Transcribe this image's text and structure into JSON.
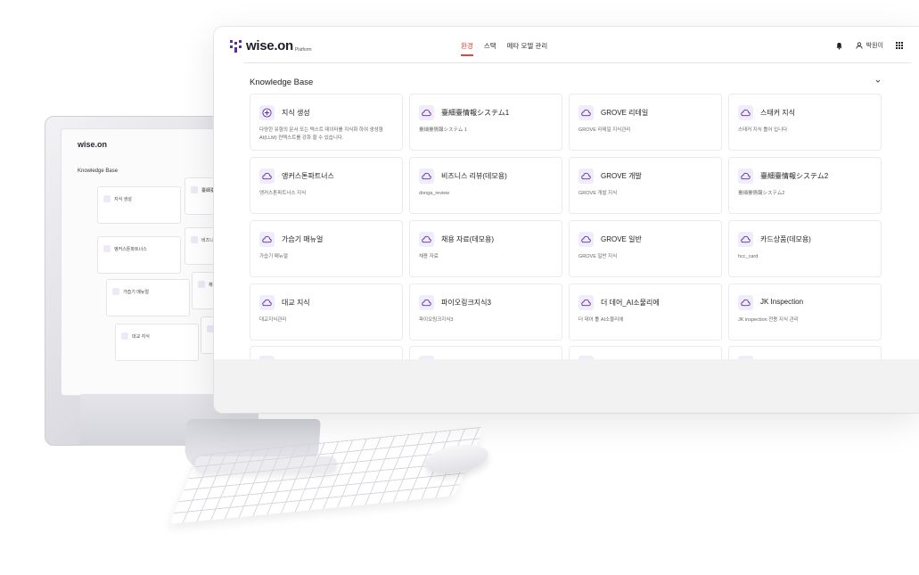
{
  "app": {
    "logo_text": "wise.on",
    "logo_sub": "Platform"
  },
  "nav": {
    "items": [
      "환경",
      "스택",
      "메타 모델 관리"
    ],
    "active_index": 0
  },
  "user": {
    "name": "박원이"
  },
  "section": {
    "title": "Knowledge Base"
  },
  "cards": [
    {
      "icon": "plus-circle-icon",
      "title": "지식 생성",
      "desc": "다양한 유형의 문서 또는 텍스트 데이터를 지식화 하여 생성형 AI(LLM) 컨텍스트를 강화 할 수 있습니다."
    },
    {
      "icon": "cloud-icon",
      "title": "臺細臺情報システム1",
      "desc": "臺細臺情報システム 1"
    },
    {
      "icon": "cloud-icon",
      "title": "GROVE 리테일",
      "desc": "GROVE 리테일 지식관리"
    },
    {
      "icon": "cloud-icon",
      "title": "스태커 지식",
      "desc": "스태커 지식 틀어 입니다"
    },
    {
      "icon": "cloud-icon",
      "title": "앵커스톤파트너스",
      "desc": "앵커스톤파트너스 지식"
    },
    {
      "icon": "cloud-icon",
      "title": "비즈니스 리뷰(데모용)",
      "desc": "donga_review"
    },
    {
      "icon": "cloud-icon",
      "title": "GROVE 개발",
      "desc": "GROVE 개발 지식"
    },
    {
      "icon": "cloud-icon",
      "title": "臺細臺情報システム2",
      "desc": "臺細臺情報システム2"
    },
    {
      "icon": "cloud-icon",
      "title": "가습기 매뉴얼",
      "desc": "가습기 매뉴얼"
    },
    {
      "icon": "cloud-icon",
      "title": "채용 자료(데모용)",
      "desc": "채용 자료"
    },
    {
      "icon": "cloud-icon",
      "title": "GROVE 일반",
      "desc": "GROVE 일반 지식"
    },
    {
      "icon": "cloud-icon",
      "title": "카드상품(데모용)",
      "desc": "hcc_card"
    },
    {
      "icon": "cloud-icon",
      "title": "대교 지식",
      "desc": "대교지식관리"
    },
    {
      "icon": "cloud-icon",
      "title": "파이오링크지식3",
      "desc": "파이오링크지식3"
    },
    {
      "icon": "cloud-icon",
      "title": "더 데어_AI소물리에",
      "desc": "더 데어 톨 AI소물리에"
    },
    {
      "icon": "cloud-icon",
      "title": "JK Inspection",
      "desc": "JK inspection 전용 지식 관리"
    }
  ],
  "mini_screen": {
    "logo_text": "wise.on",
    "section_title": "Knowledge Base",
    "cards": [
      "지식 생성",
      "臺細臺情報システム",
      "앵커스톤파트너스",
      "비즈니스",
      "가습기 매뉴얼",
      "채용",
      "대교 지식",
      "파이"
    ]
  },
  "colors": {
    "accent": "#5b2ea6",
    "active_nav": "#e0473c",
    "icon_bg": "#f1ecf9"
  }
}
